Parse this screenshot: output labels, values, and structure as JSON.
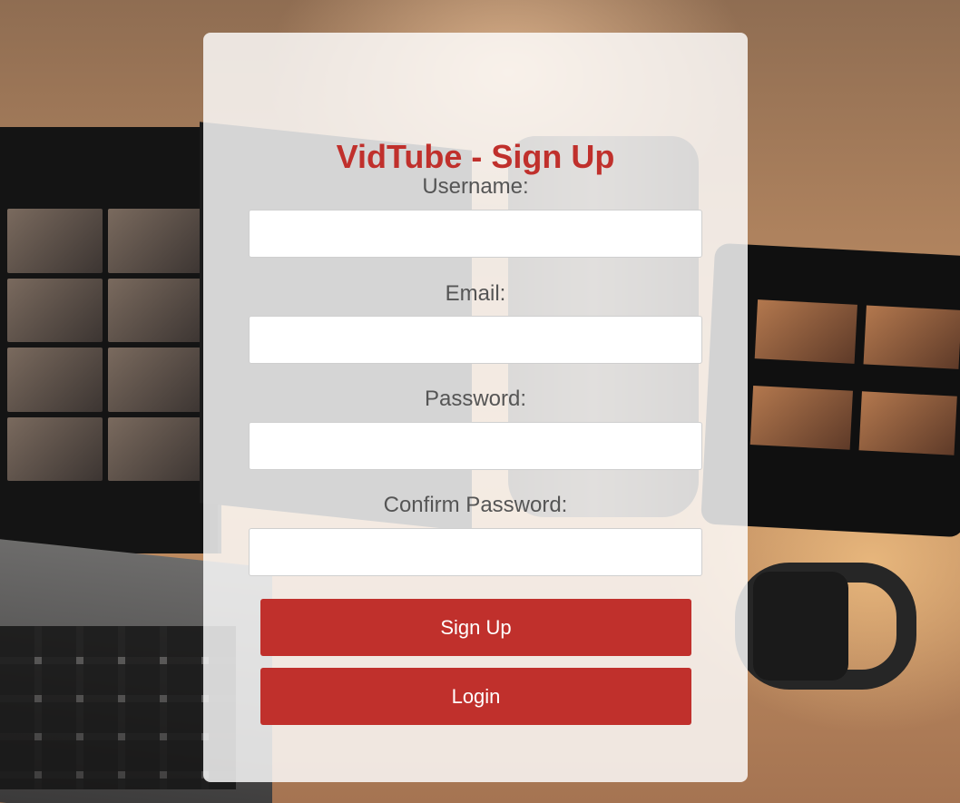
{
  "app": {
    "title": "VidTube - Sign Up"
  },
  "form": {
    "fields": [
      {
        "label": "Username:",
        "value": "",
        "placeholder": ""
      },
      {
        "label": "Email:",
        "value": "",
        "placeholder": ""
      },
      {
        "label": "Password:",
        "value": "",
        "placeholder": ""
      },
      {
        "label": "Confirm Password:",
        "value": "",
        "placeholder": ""
      }
    ],
    "signup_label": "Sign Up",
    "login_label": "Login"
  },
  "colors": {
    "accent": "#c0302c",
    "label_text": "#555555",
    "card_background": "rgba(255,255,255,0.82)"
  }
}
